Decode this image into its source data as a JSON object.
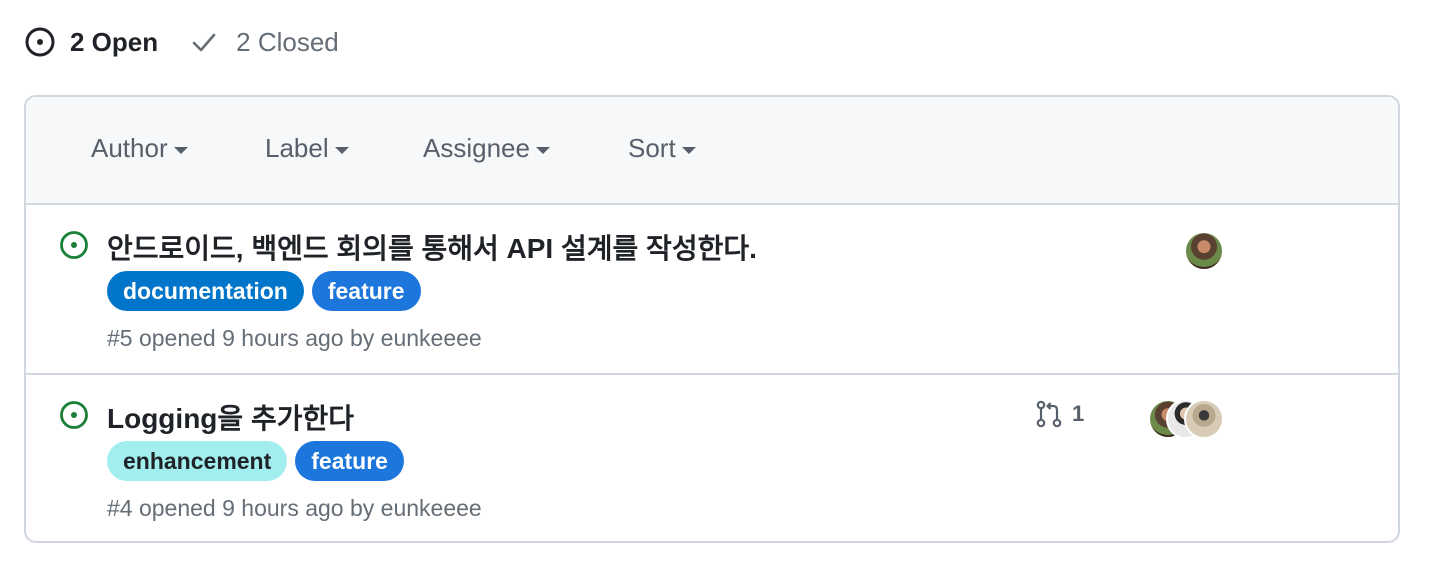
{
  "states": {
    "open_label": "2 Open",
    "closed_label": "2 Closed"
  },
  "filters": [
    {
      "label": "Author"
    },
    {
      "label": "Label"
    },
    {
      "label": "Assignee"
    },
    {
      "label": "Sort"
    }
  ],
  "issues": [
    {
      "title": "안드로이드, 백엔드 회의를 통해서 API 설계를 작성한다.",
      "labels": [
        {
          "name": "documentation",
          "bg": "#0075ca",
          "fg": "#ffffff"
        },
        {
          "name": "feature",
          "bg": "#1d76db",
          "fg": "#ffffff"
        }
      ],
      "meta": "#5 opened 9 hours ago by eunkeeee",
      "assignee_avatars": [
        "avatar-1"
      ]
    },
    {
      "title": "Logging을 추가한다",
      "labels": [
        {
          "name": "enhancement",
          "bg": "#a2eeef",
          "fg": "#1f2328"
        },
        {
          "name": "feature",
          "bg": "#1d76db",
          "fg": "#ffffff"
        }
      ],
      "linked_pr_count": "1",
      "meta": "#4 opened 9 hours ago by eunkeeee",
      "assignee_avatars": [
        "avatar-1",
        "avatar-2",
        "avatar-3"
      ]
    }
  ],
  "colors": {
    "open_green": "#1a7f37",
    "muted": "#656d76",
    "border": "#d0d7de",
    "header_bg": "#f6f8fa"
  }
}
